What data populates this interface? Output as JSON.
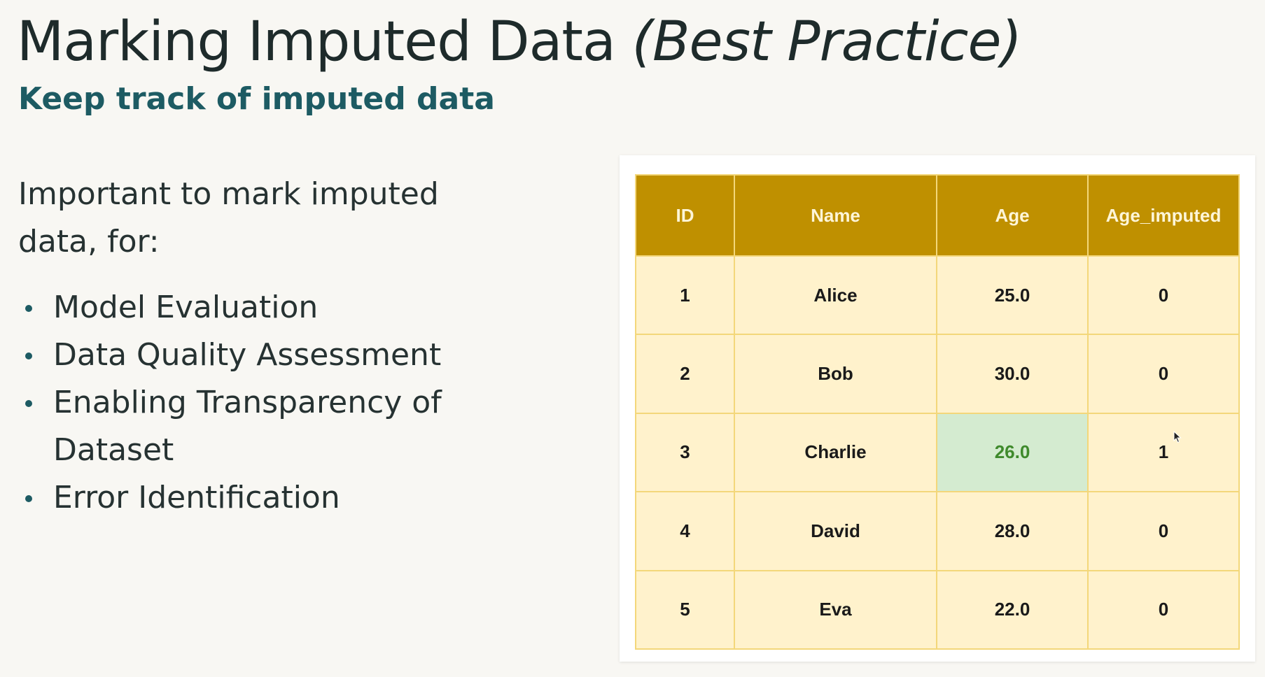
{
  "slide": {
    "title_main": "Marking Imputed Data ",
    "title_emphasis": "(Best Practice)",
    "subtitle": "Keep track of imputed data",
    "intro": "Important to mark imputed data, for:",
    "bullets": [
      {
        "label": "Model Evaluation"
      },
      {
        "label": "Data Quality Assessment"
      },
      {
        "label": "Enabling Transparency of Dataset"
      },
      {
        "label": "Error Identification"
      }
    ]
  },
  "table": {
    "headers": [
      "ID",
      "Name",
      "Age",
      "Age_imputed"
    ],
    "rows": [
      {
        "id": "1",
        "name": "Alice",
        "age": "25.0",
        "age_imputed": "0"
      },
      {
        "id": "2",
        "name": "Bob",
        "age": "30.0",
        "age_imputed": "0"
      },
      {
        "id": "3",
        "name": "Charlie",
        "age": "26.0",
        "age_imputed": "1"
      },
      {
        "id": "4",
        "name": "David",
        "age": "28.0",
        "age_imputed": "0"
      },
      {
        "id": "5",
        "name": "Eva",
        "age": "22.0",
        "age_imputed": "0"
      }
    ],
    "highlighted_row": 2,
    "colors": {
      "header_bg": "#bf9000",
      "header_text": "#fdf5d8",
      "cell_bg": "#fff2cc",
      "border": "#f3d77a",
      "imputed_bg": "#d4ebd0",
      "imputed_text": "#3f8a2c"
    }
  },
  "colors": {
    "title": "#1e2b2b",
    "subtitle": "#1d5b63",
    "body_text": "#263232",
    "background": "#f8f7f3"
  },
  "icons": {
    "cursor": "mouse-pointer-icon",
    "bullet": "bullet-dot-icon"
  }
}
